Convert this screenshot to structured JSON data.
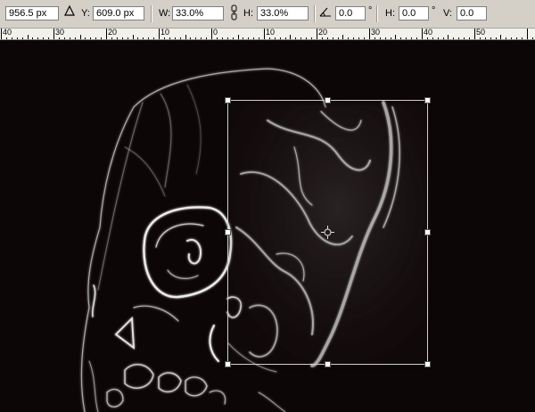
{
  "toolbar": {
    "x_value": "956.5 px",
    "y_label": "Y:",
    "y_value": "609.0 px",
    "w_label": "W:",
    "w_value": "33.0%",
    "h_label": "H:",
    "h_value": "33.0%",
    "rotate_value": "0.0",
    "rotate_unit": "°",
    "skew_h_label": "H:",
    "skew_h_value": "0.0",
    "skew_h_unit": "°",
    "skew_v_label": "V:",
    "skew_v_value": "0.0"
  },
  "ruler": {
    "labels": [
      "40",
      "30",
      "20",
      "10",
      "0",
      "10",
      "20",
      "30",
      "40",
      "50"
    ]
  },
  "colors": {
    "canvas_background": "#0d0606",
    "toolbar_background": "#d4d0c8",
    "transform_box": "#cfcfcf"
  },
  "icons": {
    "reference_point": "triangle-icon",
    "link": "chain-link-icon",
    "rotate": "angle-icon",
    "center": "crosshair-icon"
  }
}
